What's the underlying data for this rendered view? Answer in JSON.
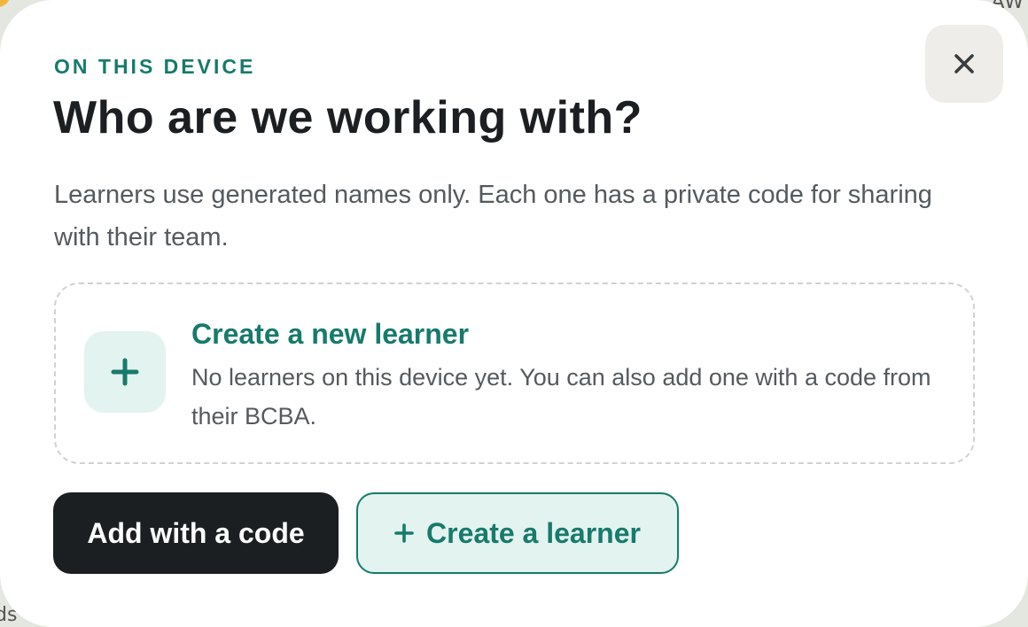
{
  "background": {
    "top_right_text": "AW",
    "bottom_left_text": "ds"
  },
  "modal": {
    "eyebrow": "ON THIS DEVICE",
    "title": "Who are we working with?",
    "description": "Learners use generated names only. Each one has a private code for sharing with their team.",
    "close_icon": "close-icon",
    "card": {
      "icon": "plus-icon",
      "title": "Create a new learner",
      "description": "No learners on this device yet. You can also add one with a code from their BCBA."
    },
    "actions": {
      "add_code_label": "Add with a code",
      "create_label": "Create a learner",
      "create_icon": "plus-icon"
    }
  },
  "colors": {
    "accent": "#177a6c",
    "accent_soft": "#e3f3ef",
    "dark": "#1c1f22",
    "muted_text": "#555a5e"
  }
}
